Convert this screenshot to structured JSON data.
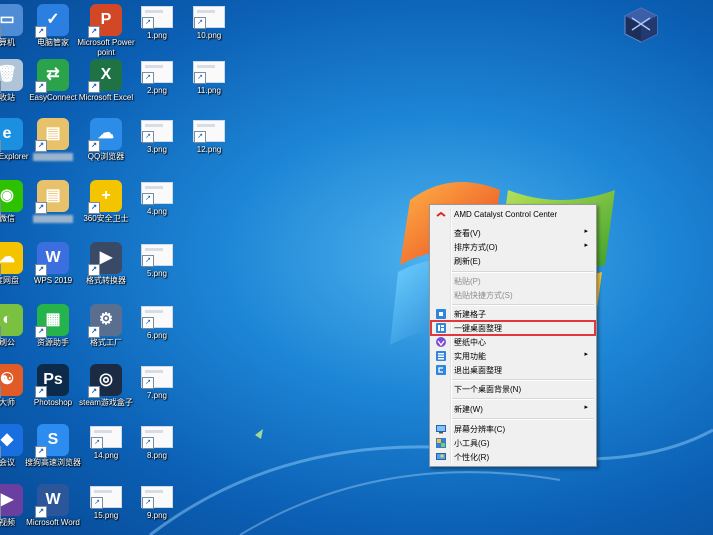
{
  "desktop": {
    "icons": [
      {
        "id": "c0r0",
        "label": "算机"
      },
      {
        "id": "c1r0",
        "label": "电脑管家"
      },
      {
        "id": "c2r0",
        "label": "Microsoft Powerpoint"
      },
      {
        "id": "c3r0",
        "label": "1.png"
      },
      {
        "id": "c4r0",
        "label": "10.png"
      },
      {
        "id": "c0r1",
        "label": "收站"
      },
      {
        "id": "c1r1",
        "label": "EasyConnect"
      },
      {
        "id": "c2r1",
        "label": "Microsoft Excel"
      },
      {
        "id": "c3r1",
        "label": "2.png"
      },
      {
        "id": "c4r1",
        "label": "11.png"
      },
      {
        "id": "c0r2",
        "label": "net Explorer"
      },
      {
        "id": "c1r2",
        "label": ""
      },
      {
        "id": "c2r2",
        "label": "QQ浏览器"
      },
      {
        "id": "c3r2",
        "label": "3.png"
      },
      {
        "id": "c4r2",
        "label": "12.png"
      },
      {
        "id": "c0r3",
        "label": "微信"
      },
      {
        "id": "c1r3",
        "label": ""
      },
      {
        "id": "c2r3",
        "label": "360安全卫士"
      },
      {
        "id": "c3r3",
        "label": "4.png"
      },
      {
        "id": "c0r4",
        "label": "度网盘"
      },
      {
        "id": "c1r4",
        "label": "WPS 2019"
      },
      {
        "id": "c2r4",
        "label": "格式转换器"
      },
      {
        "id": "c3r4",
        "label": "5.png"
      },
      {
        "id": "c0r5",
        "label": "刷公"
      },
      {
        "id": "c1r5",
        "label": "资源助手"
      },
      {
        "id": "c2r5",
        "label": "格式工厂"
      },
      {
        "id": "c3r5",
        "label": "6.png"
      },
      {
        "id": "c0r6",
        "label": "大师"
      },
      {
        "id": "c1r6",
        "label": "Photoshop"
      },
      {
        "id": "c2r6",
        "label": "steam游戏盒子"
      },
      {
        "id": "c3r6",
        "label": "7.png"
      },
      {
        "id": "c0r7",
        "label": "会议"
      },
      {
        "id": "c1r7",
        "label": "搜狗高速浏览器"
      },
      {
        "id": "c2r7",
        "label": "14.png"
      },
      {
        "id": "c3r7",
        "label": "8.png"
      },
      {
        "id": "c0r8",
        "label": "视频"
      },
      {
        "id": "c1r8",
        "label": "Microsoft Word"
      },
      {
        "id": "c2r8",
        "label": "15.png"
      },
      {
        "id": "c3r8",
        "label": "9.png"
      }
    ]
  },
  "context_menu": {
    "items": [
      {
        "label": "AMD Catalyst Control Center",
        "icon": "amd-icon",
        "disabled": false,
        "submenu": false
      },
      {
        "label": "查看(V)",
        "icon": "",
        "disabled": false,
        "submenu": true
      },
      {
        "label": "排序方式(O)",
        "icon": "",
        "disabled": false,
        "submenu": true
      },
      {
        "label": "刷新(E)",
        "icon": "",
        "disabled": false,
        "submenu": false
      },
      {
        "label": "粘贴(P)",
        "icon": "",
        "disabled": true,
        "submenu": false
      },
      {
        "label": "粘贴快捷方式(S)",
        "icon": "",
        "disabled": true,
        "submenu": false
      },
      {
        "label": "新建格子",
        "icon": "fence-icon",
        "disabled": false,
        "submenu": false
      },
      {
        "label": "一键桌面整理",
        "icon": "organize-icon",
        "disabled": false,
        "submenu": false
      },
      {
        "label": "壁纸中心",
        "icon": "wallpaper-icon",
        "disabled": false,
        "submenu": false
      },
      {
        "label": "实用功能",
        "icon": "tools-icon",
        "disabled": false,
        "submenu": true
      },
      {
        "label": "退出桌面整理",
        "icon": "exit-icon",
        "disabled": false,
        "submenu": false
      },
      {
        "label": "下一个桌面背景(N)",
        "icon": "",
        "disabled": false,
        "submenu": false
      },
      {
        "label": "新建(W)",
        "icon": "",
        "disabled": false,
        "submenu": true
      },
      {
        "label": "屏幕分辨率(C)",
        "icon": "monitor-icon",
        "disabled": false,
        "submenu": false
      },
      {
        "label": "小工具(G)",
        "icon": "gadgets-icon",
        "disabled": false,
        "submenu": false
      },
      {
        "label": "个性化(R)",
        "icon": "personalize-icon",
        "disabled": false,
        "submenu": false
      }
    ],
    "submenu_arrow": "▸",
    "highlighted": "一键桌面整理"
  },
  "colors": {
    "highlight_border": "#e0393c",
    "menu_bg": "#f0f0f0"
  }
}
